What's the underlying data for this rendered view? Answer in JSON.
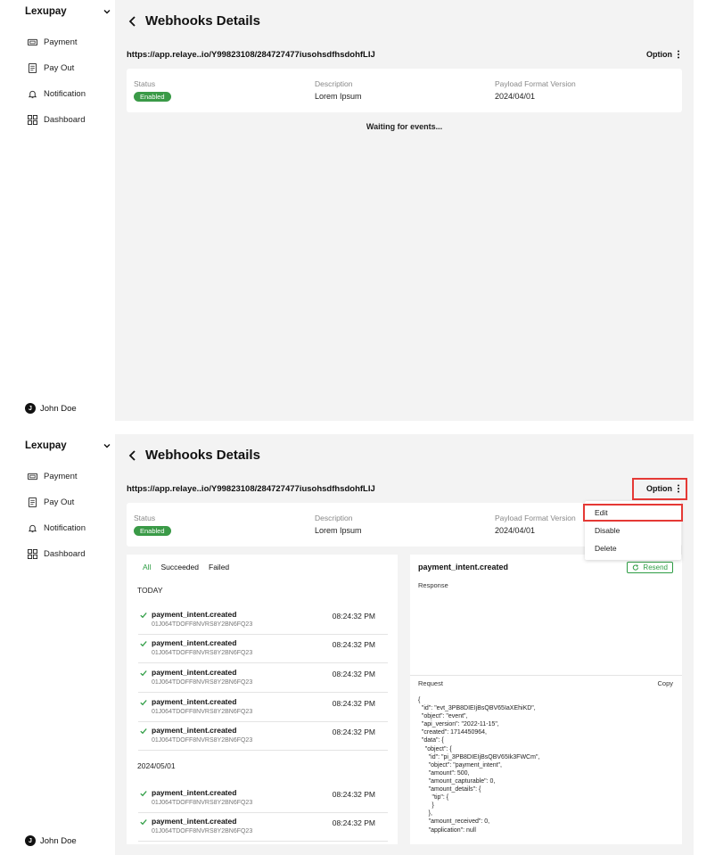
{
  "app": {
    "brand": "Lexupay",
    "user_initial": "J",
    "user_name": "John Doe"
  },
  "nav": [
    {
      "label": "Payment",
      "icon": "payment-icon"
    },
    {
      "label": "Pay Out",
      "icon": "payout-icon"
    },
    {
      "label": "Notification",
      "icon": "bell-icon"
    },
    {
      "label": "Dashboard",
      "icon": "dashboard-icon"
    }
  ],
  "page": {
    "title": "Webhooks Details",
    "url": "https://app.relaye..io/Y99823108/284727477iusohsdfhsdohfLIJ",
    "option_label": "Option"
  },
  "info": {
    "status_label": "Status",
    "status_value": "Enabled",
    "description_label": "Description",
    "description_value": "Lorem Ipsum",
    "payload_label": "Payload Format Version",
    "payload_value": "2024/04/01"
  },
  "waiting": "Waiting for events...",
  "menu": {
    "edit": "Edit",
    "disable": "Disable",
    "delete": "Delete"
  },
  "tabs": {
    "all": "All",
    "succeeded": "Succeeded",
    "failed": "Failed"
  },
  "groups": {
    "today": "TODAY",
    "date": "2024/05/01"
  },
  "events": [
    {
      "name": "payment_intent.created",
      "id": "01J064TDOFF8NVRS8Y2BN6FQ23",
      "time": "08:24:32 PM"
    },
    {
      "name": "payment_intent.created",
      "id": "01J064TDOFF8NVRS8Y2BN6FQ23",
      "time": "08:24:32 PM"
    },
    {
      "name": "payment_intent.created",
      "id": "01J064TDOFF8NVRS8Y2BN6FQ23",
      "time": "08:24:32 PM"
    },
    {
      "name": "payment_intent.created",
      "id": "01J064TDOFF8NVRS8Y2BN6FQ23",
      "time": "08:24:32 PM"
    },
    {
      "name": "payment_intent.created",
      "id": "01J064TDOFF8NVRS8Y2BN6FQ23",
      "time": "08:24:32 PM"
    },
    {
      "name": "payment_intent.created",
      "id": "01J064TDOFF8NVRS8Y2BN6FQ23",
      "time": "08:24:32 PM"
    },
    {
      "name": "payment_intent.created",
      "id": "01J064TDOFF8NVRS8Y2BN6FQ23",
      "time": "08:24:32 PM"
    }
  ],
  "detail": {
    "title": "payment_intent.created",
    "resend": "Resend",
    "response_label": "Response",
    "request_label": "Request",
    "copy_label": "Copy",
    "code": "{\n  \"id\": \"evt_3PB8DIEIjBsQBV65IaXEhiKD\",\n  \"object\": \"event\",\n  \"api_version\": \"2022-11-15\",\n  \"created\": 1714450964,\n  \"data\": {\n    \"object\": {\n      \"id\": \"pi_3PB8DIEIjBsQBV65Ik3FWCm\",\n      \"object\": \"payment_intent\",\n      \"amount\": 500,\n      \"amount_capturable\": 0,\n      \"amount_details\": {\n        \"tip\": {\n        }\n      },\n      \"amount_received\": 0,\n      \"application\": null"
  },
  "colors": {
    "accent_green": "#2e9d44",
    "highlight_red": "#e53935",
    "main_bg": "#f3f3f3"
  }
}
